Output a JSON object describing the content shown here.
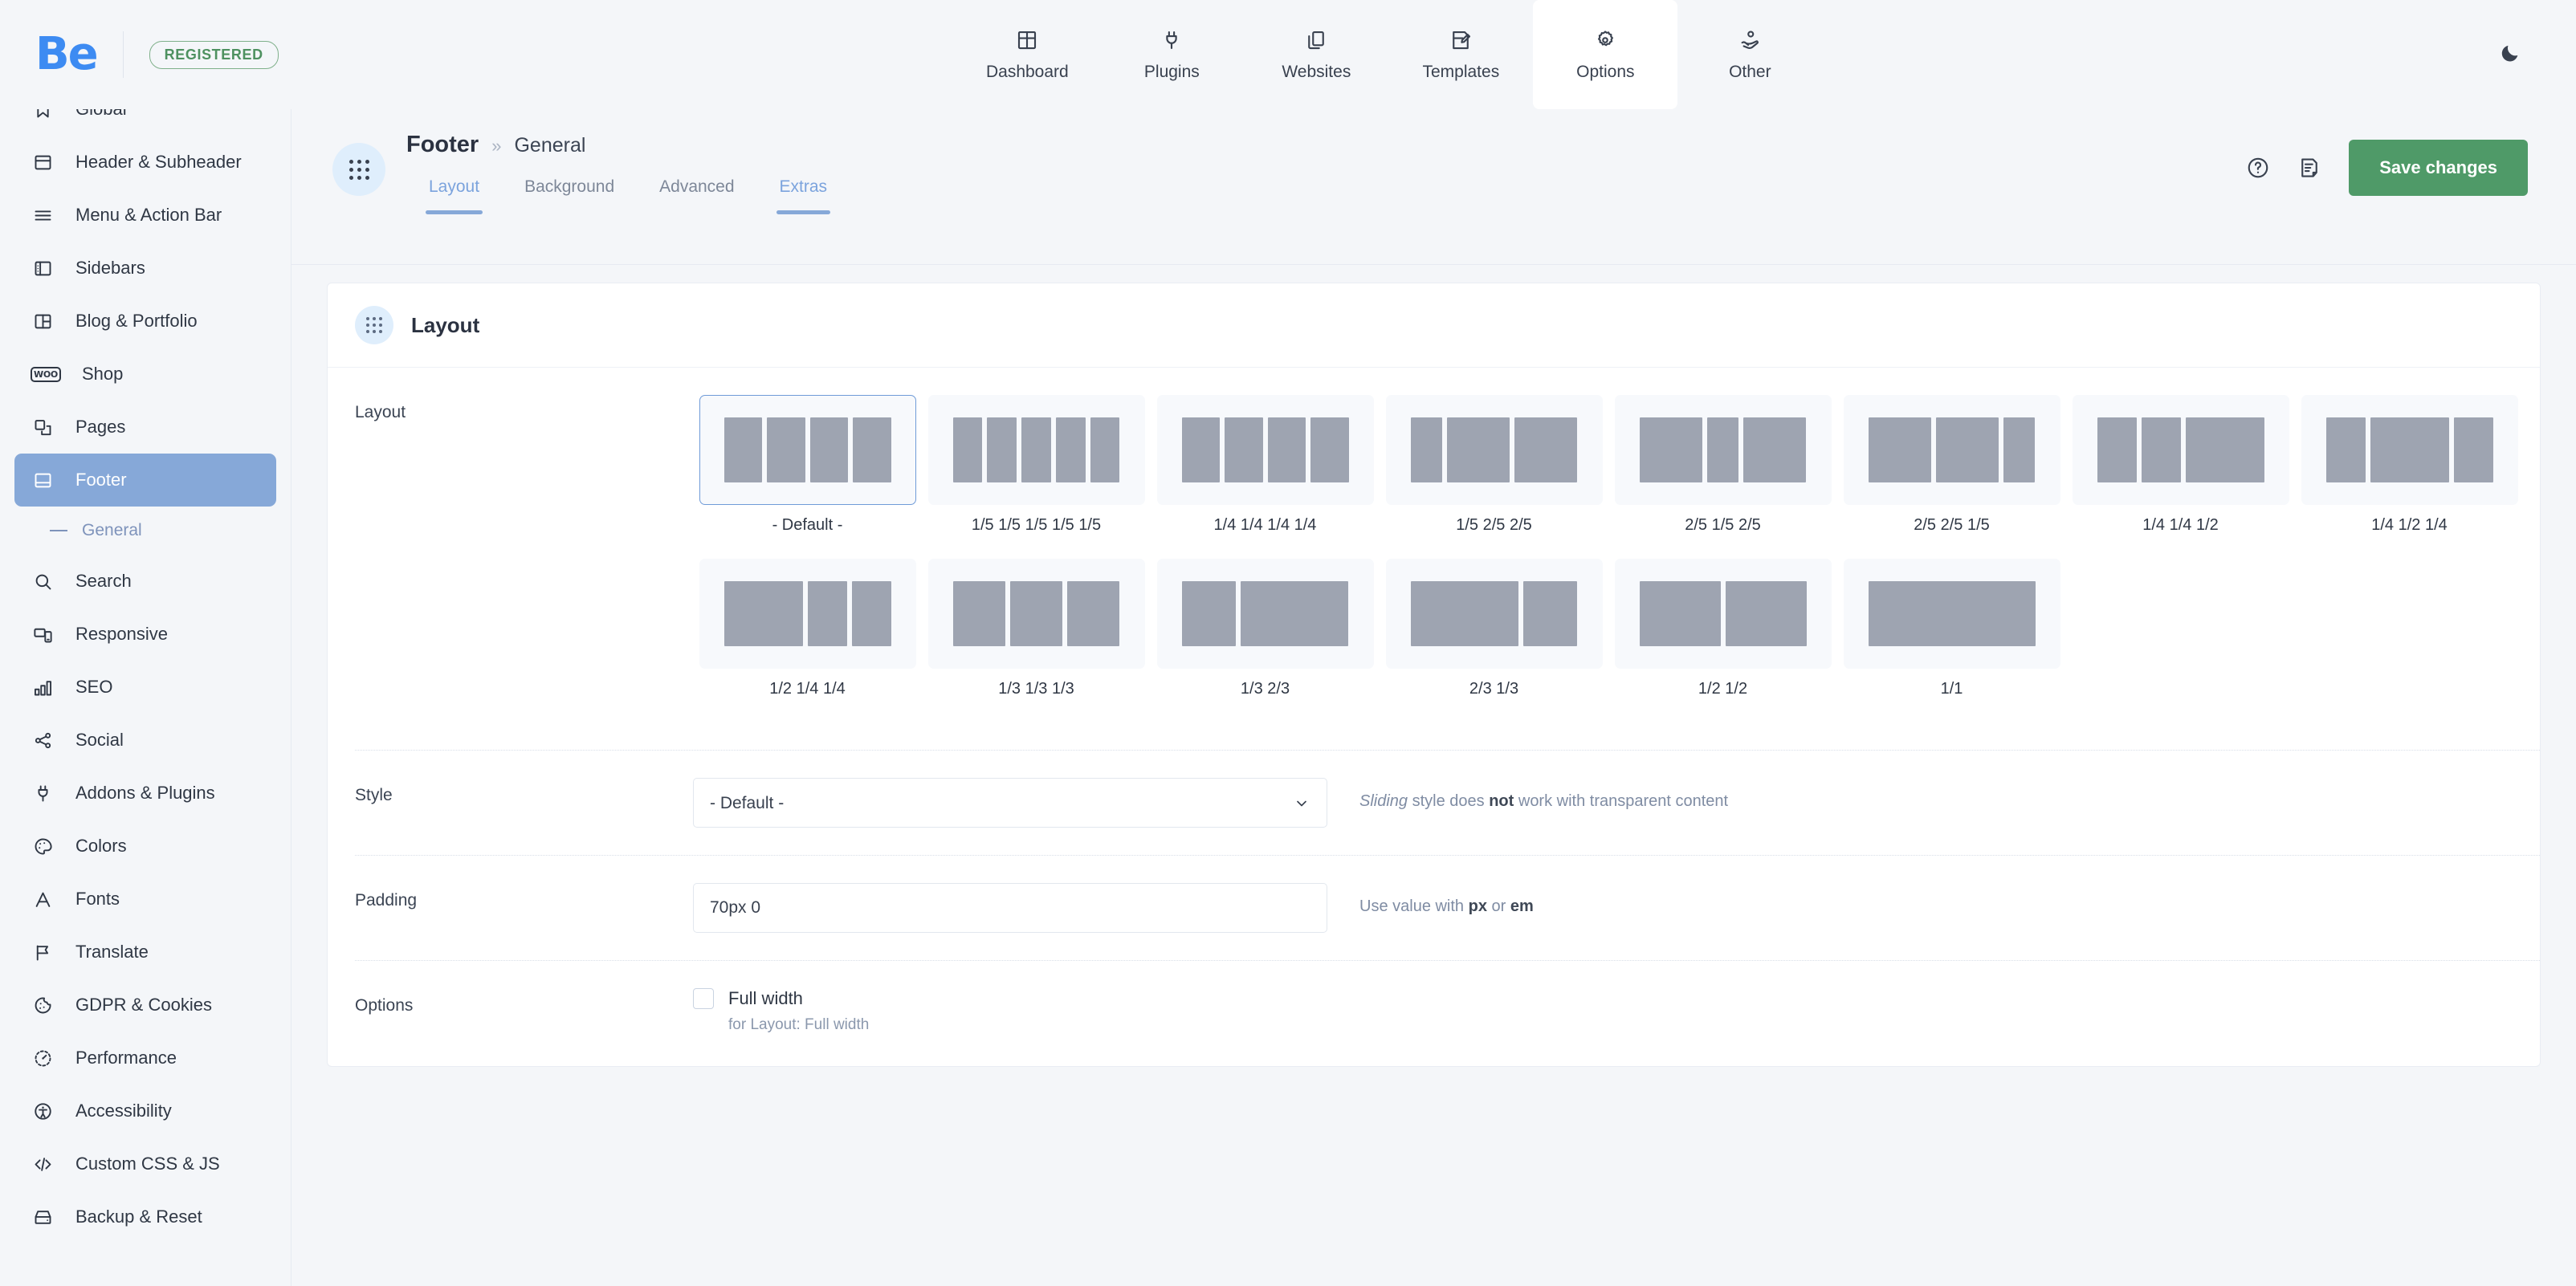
{
  "topbar": {
    "logo_text": "Be",
    "badge": "REGISTERED",
    "nav": [
      {
        "label": "Dashboard",
        "icon": "grid-window-icon",
        "active": false
      },
      {
        "label": "Plugins",
        "icon": "plug-icon",
        "active": false
      },
      {
        "label": "Websites",
        "icon": "copy-pages-icon",
        "active": false
      },
      {
        "label": "Templates",
        "icon": "document-edit-icon",
        "active": false
      },
      {
        "label": "Options",
        "icon": "gear-icon",
        "active": true
      },
      {
        "label": "Other",
        "icon": "hand-person-icon",
        "active": false
      }
    ],
    "dark_mode_icon": "moon-icon"
  },
  "sidebar": {
    "items": [
      {
        "label": "Global",
        "icon": "bookmark-icon",
        "active": false,
        "partial": true
      },
      {
        "label": "Header & Subheader",
        "icon": "header-layout-icon",
        "active": false
      },
      {
        "label": "Menu & Action Bar",
        "icon": "hamburger-icon",
        "active": false
      },
      {
        "label": "Sidebars",
        "icon": "sidebar-icon",
        "active": false
      },
      {
        "label": "Blog & Portfolio",
        "icon": "columns-layout-icon",
        "active": false
      },
      {
        "label": "Shop",
        "icon": "woo-icon",
        "active": false
      },
      {
        "label": "Pages",
        "icon": "pages-icon",
        "active": false
      },
      {
        "label": "Footer",
        "icon": "footer-layout-icon",
        "active": true
      },
      {
        "label": "General",
        "icon": "dash-icon",
        "active": false,
        "sub": true
      },
      {
        "label": "Search",
        "icon": "search-icon",
        "active": false
      },
      {
        "label": "Responsive",
        "icon": "responsive-icon",
        "active": false
      },
      {
        "label": "SEO",
        "icon": "bar-chart-icon",
        "active": false
      },
      {
        "label": "Social",
        "icon": "share-icon",
        "active": false
      },
      {
        "label": "Addons & Plugins",
        "icon": "plug-icon",
        "active": false
      },
      {
        "label": "Colors",
        "icon": "palette-icon",
        "active": false
      },
      {
        "label": "Fonts",
        "icon": "letter-a-icon",
        "active": false
      },
      {
        "label": "Translate",
        "icon": "flag-icon",
        "active": false
      },
      {
        "label": "GDPR & Cookies",
        "icon": "cookie-icon",
        "active": false
      },
      {
        "label": "Performance",
        "icon": "gauge-icon",
        "active": false
      },
      {
        "label": "Accessibility",
        "icon": "accessibility-icon",
        "active": false
      },
      {
        "label": "Custom CSS & JS",
        "icon": "code-icon",
        "active": false
      },
      {
        "label": "Backup & Reset",
        "icon": "drive-icon",
        "active": false
      }
    ]
  },
  "page_header": {
    "icon": "dots-grid-icon",
    "breadcrumb_main": "Footer",
    "breadcrumb_sep": "»",
    "breadcrumb_sub": "General",
    "tabs": [
      {
        "label": "Layout",
        "accent": true,
        "underlined": true
      },
      {
        "label": "Background",
        "accent": false,
        "underlined": false
      },
      {
        "label": "Advanced",
        "accent": false,
        "underlined": false
      },
      {
        "label": "Extras",
        "accent": true,
        "underlined": true
      }
    ],
    "help_icon": "question-circle-icon",
    "notes_icon": "note-edit-icon",
    "save_label": "Save changes"
  },
  "card": {
    "icon": "dots-grid-icon",
    "title": "Layout",
    "rows": {
      "layout_label": "Layout",
      "style_label": "Style",
      "padding_label": "Padding",
      "options_label": "Options"
    },
    "layout_options": [
      {
        "label": "- Default -",
        "cols": [
          1,
          1,
          1,
          1
        ],
        "selected": true
      },
      {
        "label": "1/5 1/5 1/5 1/5 1/5",
        "cols": [
          1,
          1,
          1,
          1,
          1
        ],
        "selected": false
      },
      {
        "label": "1/4 1/4 1/4 1/4",
        "cols": [
          1,
          1,
          1,
          1
        ],
        "selected": false
      },
      {
        "label": "1/5 2/5 2/5",
        "cols": [
          1,
          2,
          2
        ],
        "selected": false
      },
      {
        "label": "2/5 1/5 2/5",
        "cols": [
          2,
          1,
          2
        ],
        "selected": false
      },
      {
        "label": "2/5 2/5 1/5",
        "cols": [
          2,
          2,
          1
        ],
        "selected": false
      },
      {
        "label": "1/4 1/4 1/2",
        "cols": [
          1,
          1,
          2
        ],
        "selected": false
      },
      {
        "label": "1/4 1/2 1/4",
        "cols": [
          1,
          2,
          1
        ],
        "selected": false
      },
      {
        "label": "1/2 1/4 1/4",
        "cols": [
          2,
          1,
          1
        ],
        "selected": false
      },
      {
        "label": "1/3 1/3 1/3",
        "cols": [
          1,
          1,
          1
        ],
        "selected": false
      },
      {
        "label": "1/3 2/3",
        "cols": [
          1,
          2
        ],
        "selected": false
      },
      {
        "label": "2/3 1/3",
        "cols": [
          2,
          1
        ],
        "selected": false
      },
      {
        "label": "1/2 1/2",
        "cols": [
          1,
          1
        ],
        "selected": false
      },
      {
        "label": "1/1",
        "cols": [
          1
        ],
        "selected": false
      }
    ],
    "style": {
      "value": "- Default -",
      "options": [
        "- Default -"
      ],
      "hint_pre": "Sliding",
      "hint_mid": " style does ",
      "hint_bold": "not",
      "hint_post": " work with transparent content"
    },
    "padding": {
      "value": "70px 0",
      "hint_pre": "Use value with ",
      "hint_b1": "px",
      "hint_mid": " or ",
      "hint_b2": "em"
    },
    "options": {
      "checkbox_label": "Full width",
      "checkbox_sub": "for Layout: Full width",
      "checked": false
    }
  },
  "colors": {
    "brand_blue": "#3d8bf2",
    "accent_blue": "#86a8d8",
    "save_green": "#4f9a68",
    "registered_green": "#4e9160",
    "tile_gray": "#9ea4b1",
    "page_bg": "#f4f6f9"
  }
}
